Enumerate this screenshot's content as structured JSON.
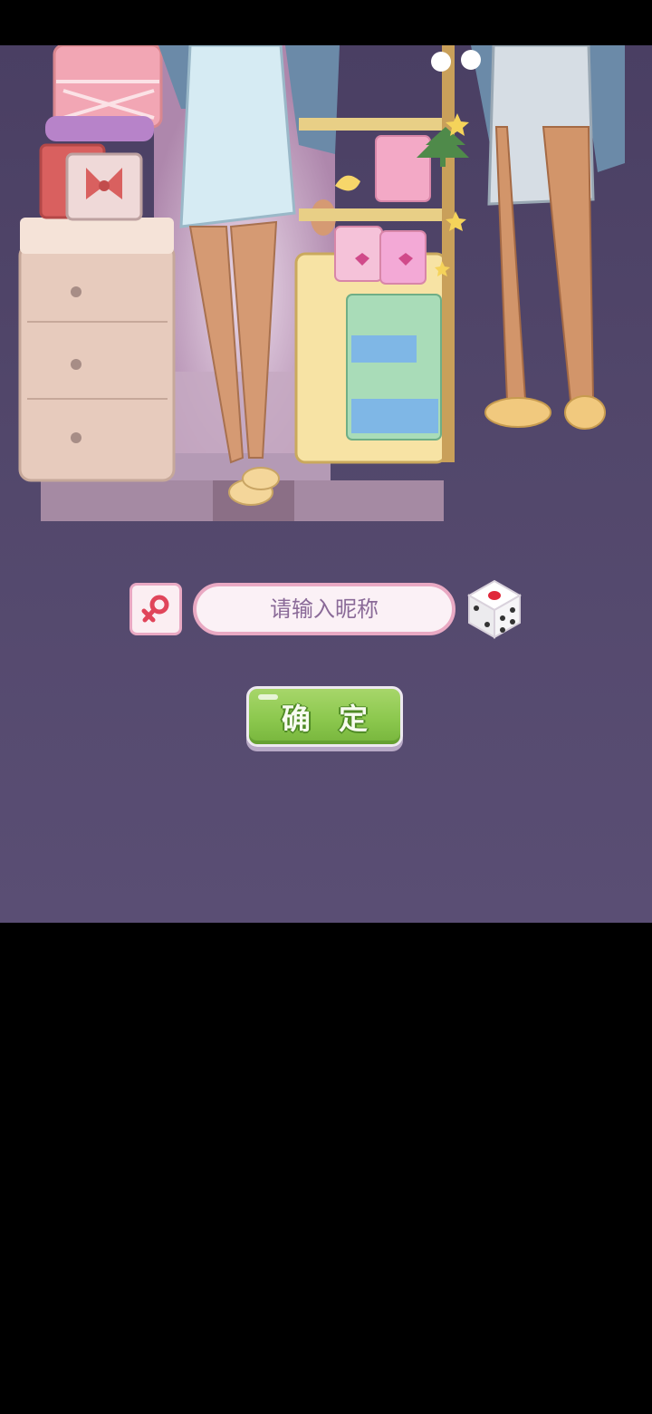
{
  "nickname_form": {
    "placeholder": "请输入昵称",
    "value": "",
    "gender": "female",
    "gender_icon": "female-symbol-icon",
    "random_icon": "dice-icon"
  },
  "confirm_button": {
    "label": "确 定"
  },
  "colors": {
    "background": "#52476b",
    "input_border": "#e9a9c3",
    "input_fill": "#fbf1f6",
    "button_green": "#8cc84e",
    "gender_red": "#e0455a"
  }
}
